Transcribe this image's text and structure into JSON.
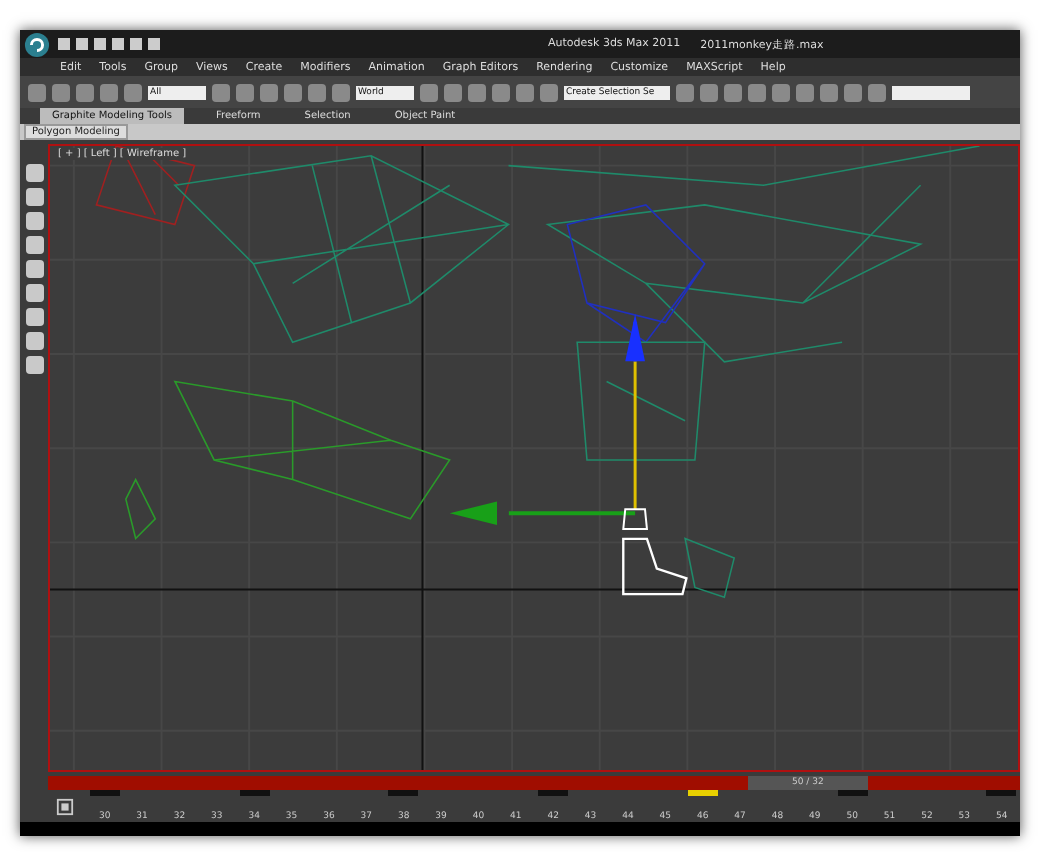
{
  "window": {
    "title": "Autodesk 3ds Max  2011",
    "file": "2011monkey走路.max"
  },
  "menu": [
    "Edit",
    "Tools",
    "Group",
    "Views",
    "Create",
    "Modifiers",
    "Animation",
    "Graph Editors",
    "Rendering",
    "Customize",
    "MAXScript",
    "Help"
  ],
  "toolbar": {
    "filter": "All",
    "coordinate_system": "World",
    "selection_set": "Create Selection Se"
  },
  "ribbon_tabs": [
    {
      "label": "Graphite Modeling Tools",
      "selected": true
    },
    {
      "label": "Freeform",
      "selected": false
    },
    {
      "label": "Selection",
      "selected": false
    },
    {
      "label": "Object Paint",
      "selected": false
    }
  ],
  "ribbon_panel": "Polygon Modeling",
  "viewport": {
    "label": "[ + ] [ Left ] [ Wireframe ]"
  },
  "time_slider": {
    "text": "50 / 32",
    "level": 0.86
  },
  "frames": [
    {
      "label": "30",
      "key": true,
      "selected": false
    },
    {
      "label": "31",
      "key": false,
      "selected": false
    },
    {
      "label": "32",
      "key": false,
      "selected": false
    },
    {
      "label": "33",
      "key": false,
      "selected": false
    },
    {
      "label": "34",
      "key": true,
      "selected": false
    },
    {
      "label": "35",
      "key": false,
      "selected": false
    },
    {
      "label": "36",
      "key": false,
      "selected": false
    },
    {
      "label": "37",
      "key": false,
      "selected": false
    },
    {
      "label": "38",
      "key": true,
      "selected": false
    },
    {
      "label": "39",
      "key": false,
      "selected": false
    },
    {
      "label": "40",
      "key": false,
      "selected": false
    },
    {
      "label": "41",
      "key": false,
      "selected": false
    },
    {
      "label": "42",
      "key": true,
      "selected": false
    },
    {
      "label": "43",
      "key": false,
      "selected": false
    },
    {
      "label": "44",
      "key": false,
      "selected": false
    },
    {
      "label": "45",
      "key": false,
      "selected": false
    },
    {
      "label": "46",
      "key": true,
      "selected": true
    },
    {
      "label": "47",
      "key": false,
      "selected": false
    },
    {
      "label": "48",
      "key": false,
      "selected": false
    },
    {
      "label": "49",
      "key": false,
      "selected": false
    },
    {
      "label": "50",
      "key": true,
      "selected": false
    },
    {
      "label": "51",
      "key": false,
      "selected": false
    },
    {
      "label": "52",
      "key": false,
      "selected": false
    },
    {
      "label": "53",
      "key": false,
      "selected": false
    },
    {
      "label": "54",
      "key": true,
      "selected": false
    }
  ]
}
